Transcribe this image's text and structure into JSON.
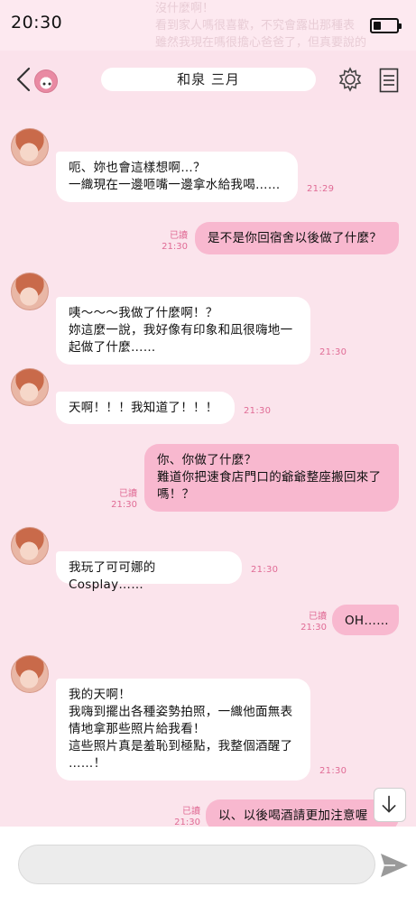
{
  "status": {
    "time": "20:30",
    "battery_level": 0.35,
    "background_text": "沒什麼啊！\n看到家人嗎很喜歡，不究會露出那種表\n雖然我現在嗎很擔心爸爸了，但真要說的\n話……媽媽不可能我們好很那是\n這樣美名喔（一）笑"
  },
  "header": {
    "title": "和泉 三月",
    "back_icon": "chevron-left-icon",
    "avatar_icon": "sticker-avatar-icon",
    "settings_icon": "gear-icon",
    "menu_icon": "document-menu-icon"
  },
  "messages": [
    {
      "side": "in",
      "text": "呃、妳也會這樣想啊…？\n一織現在一邊咂嘴一邊拿水給我喝……",
      "time": "21:29"
    },
    {
      "side": "out",
      "text": "是不是你回宿舍以後做了什麼？",
      "time": "21:30",
      "read": "已讀"
    },
    {
      "side": "in",
      "text": "咦～～～我做了什麼啊！？\n妳這麼一說，我好像有印象和凪很嗨地一\n起做了什麼……",
      "time": "21:30"
    },
    {
      "side": "in",
      "text": "天啊！！！我知道了！！！",
      "time": "21:30"
    },
    {
      "side": "out",
      "text": "你、你做了什麼？\n難道你把速食店門口的爺爺整座搬回來了\n嗎！？",
      "time": "21:30",
      "read": "已讀"
    },
    {
      "side": "in",
      "text": "我玩了可可娜的Cosplay……",
      "time": "21:30"
    },
    {
      "side": "out",
      "text": "OH……",
      "time": "21:30",
      "read": "已讀"
    },
    {
      "side": "in",
      "text": "我的天啊！\n我嗨到擺出各種姿勢拍照，一織他面無表\n情地拿那些照片給我看！\n這些照片真是羞恥到極點，我整個酒醒了\n……！",
      "time": "21:30"
    },
    {
      "side": "out",
      "text": "以、以後喝酒請更加注意喔",
      "time": "21:30",
      "read": "已讀"
    }
  ],
  "composer": {
    "placeholder": "",
    "value": "",
    "send_icon": "send-icon"
  },
  "scroll_down_icon": "arrow-down-icon",
  "colors": {
    "background": "#fbe4ec",
    "outgoing_bubble": "#f8b8cf",
    "incoming_bubble": "#ffffff",
    "timestamp": "#e06b95"
  }
}
